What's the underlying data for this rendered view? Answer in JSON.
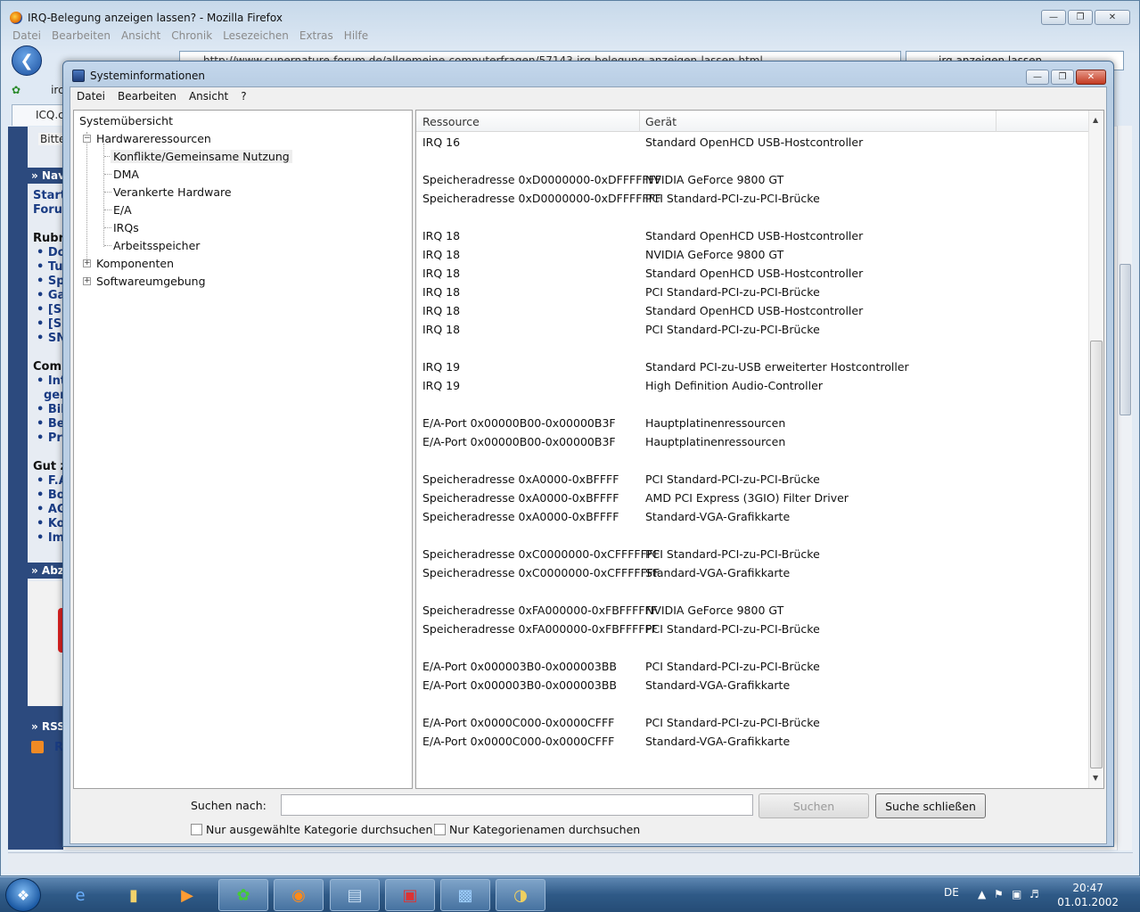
{
  "firefox": {
    "title": "IRQ-Belegung anzeigen lassen? - Mozilla Firefox",
    "menu": [
      "Datei",
      "Bearbeiten",
      "Ansicht",
      "Chronik",
      "Lesezeichen",
      "Extras",
      "Hilfe"
    ],
    "url": "http://www.supernature-forum.de/allgemeine-computerfragen/57143-irq-belegung-anzeigen-lassen.html",
    "search": "irq anzeigen lassen",
    "bookmark_partial": "irc",
    "tab_label": "ICQ.c",
    "web": {
      "bitte": "Bitte",
      "nav_header": "» Nav",
      "links_top": [
        "Start",
        "Foru"
      ],
      "rubrik": "Rubri",
      "rubrik_items": [
        "• Do",
        "• Tu",
        "• Sp",
        "• Ga",
        "• [Sl",
        "• [Sl",
        "• SN"
      ],
      "comm": "Comm",
      "comm_items": [
        "• Int",
        "ger",
        "• Bil",
        "• Be",
        "• Pro"
      ],
      "gut": "Gut z",
      "gut_items": [
        "• F.A",
        "• Bo",
        "• AG",
        "• Ko",
        "• Im"
      ],
      "abz_header": "» Abz",
      "rss_header": "» RSS",
      "rss_text": "R"
    }
  },
  "sysinfo": {
    "title": "Systeminformationen",
    "menu": [
      "Datei",
      "Bearbeiten",
      "Ansicht",
      "?"
    ],
    "tree": {
      "root": "Systemübersicht",
      "hardware": "Hardwareressourcen",
      "hw_children": [
        "Konflikte/Gemeinsame Nutzung",
        "DMA",
        "Verankerte Hardware",
        "E/A",
        "IRQs",
        "Arbeitsspeicher"
      ],
      "components": "Komponenten",
      "software": "Softwareumgebung"
    },
    "columns": [
      "Ressource",
      "Gerät"
    ],
    "rows": [
      [
        "IRQ 16",
        "Standard OpenHCD USB-Hostcontroller"
      ],
      [
        "",
        ""
      ],
      [
        "Speicheradresse 0xD0000000-0xDFFFFFFF",
        "NVIDIA GeForce 9800 GT"
      ],
      [
        "Speicheradresse 0xD0000000-0xDFFFFFFF",
        "PCI Standard-PCI-zu-PCI-Brücke"
      ],
      [
        "",
        ""
      ],
      [
        "IRQ 18",
        "Standard OpenHCD USB-Hostcontroller"
      ],
      [
        "IRQ 18",
        "NVIDIA GeForce 9800 GT"
      ],
      [
        "IRQ 18",
        "Standard OpenHCD USB-Hostcontroller"
      ],
      [
        "IRQ 18",
        "PCI Standard-PCI-zu-PCI-Brücke"
      ],
      [
        "IRQ 18",
        "Standard OpenHCD USB-Hostcontroller"
      ],
      [
        "IRQ 18",
        "PCI Standard-PCI-zu-PCI-Brücke"
      ],
      [
        "",
        ""
      ],
      [
        "IRQ 19",
        "Standard PCI-zu-USB erweiterter Hostcontroller"
      ],
      [
        "IRQ 19",
        "High Definition Audio-Controller"
      ],
      [
        "",
        ""
      ],
      [
        "E/A-Port 0x00000B00-0x00000B3F",
        "Hauptplatinenressourcen"
      ],
      [
        "E/A-Port 0x00000B00-0x00000B3F",
        "Hauptplatinenressourcen"
      ],
      [
        "",
        ""
      ],
      [
        "Speicheradresse 0xA0000-0xBFFFF",
        "PCI Standard-PCI-zu-PCI-Brücke"
      ],
      [
        "Speicheradresse 0xA0000-0xBFFFF",
        "AMD PCI Express (3GIO) Filter Driver"
      ],
      [
        "Speicheradresse 0xA0000-0xBFFFF",
        "Standard-VGA-Grafikkarte"
      ],
      [
        "",
        ""
      ],
      [
        "Speicheradresse 0xC0000000-0xCFFFFFFF",
        "PCI Standard-PCI-zu-PCI-Brücke"
      ],
      [
        "Speicheradresse 0xC0000000-0xCFFFFFFF",
        "Standard-VGA-Grafikkarte"
      ],
      [
        "",
        ""
      ],
      [
        "Speicheradresse 0xFA000000-0xFBFFFFFF",
        "NVIDIA GeForce 9800 GT"
      ],
      [
        "Speicheradresse 0xFA000000-0xFBFFFFFF",
        "PCI Standard-PCI-zu-PCI-Brücke"
      ],
      [
        "",
        ""
      ],
      [
        "E/A-Port 0x000003B0-0x000003BB",
        "PCI Standard-PCI-zu-PCI-Brücke"
      ],
      [
        "E/A-Port 0x000003B0-0x000003BB",
        "Standard-VGA-Grafikkarte"
      ],
      [
        "",
        ""
      ],
      [
        "E/A-Port 0x0000C000-0x0000CFFF",
        "PCI Standard-PCI-zu-PCI-Brücke"
      ],
      [
        "E/A-Port 0x0000C000-0x0000CFFF",
        "Standard-VGA-Grafikkarte"
      ]
    ],
    "search_label": "Suchen nach:",
    "search_value": "",
    "search_button": "Suchen",
    "close_search_button": "Suche schließen",
    "check_selected": "Nur ausgewählte Kategorie durchsuchen",
    "check_names": "Nur Kategorienamen durchsuchen"
  },
  "taskbar": {
    "language": "DE",
    "time": "20:47",
    "date": "01.01.2002",
    "apps": [
      "ie-icon",
      "folder-icon",
      "media-player-icon",
      "icq-icon",
      "firefox-icon",
      "sysinfo-icon",
      "toolbox-icon",
      "monitor-info-icon",
      "paint-icon"
    ]
  }
}
